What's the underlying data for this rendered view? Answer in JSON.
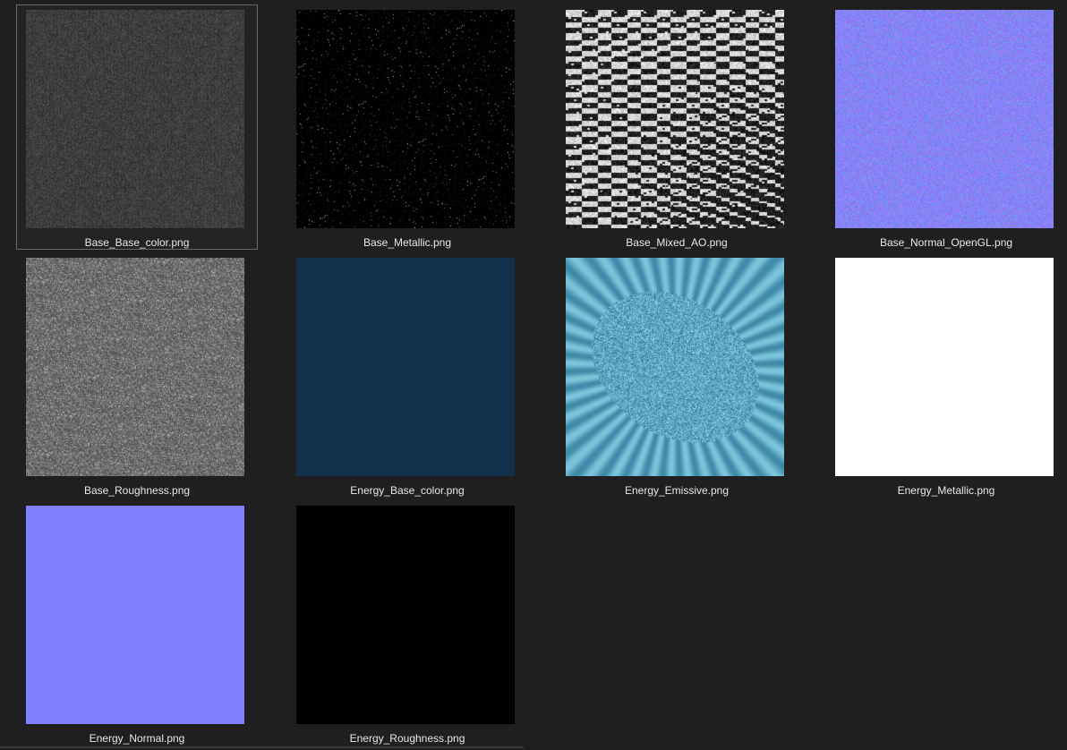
{
  "files": [
    {
      "name": "Base_Base_color.png",
      "selected": true,
      "kind": "noise-gray",
      "colors": [
        "#3c3c3c",
        "#4a4a4a",
        "#2e2e2e"
      ]
    },
    {
      "name": "Base_Metallic.png",
      "selected": false,
      "kind": "noise-dark",
      "colors": [
        "#000000",
        "#555555"
      ]
    },
    {
      "name": "Base_Mixed_AO.png",
      "selected": false,
      "kind": "noise-bw",
      "colors": [
        "#000000",
        "#ffffff"
      ]
    },
    {
      "name": "Base_Normal_OpenGL.png",
      "selected": false,
      "kind": "noise-normal",
      "colors": [
        "#7f7fff",
        "#a070e8",
        "#60b8d8",
        "#c080f0"
      ]
    },
    {
      "name": "Base_Roughness.png",
      "selected": false,
      "kind": "noise-gray-light",
      "colors": [
        "#6a6a6a",
        "#8a8a8a",
        "#505050"
      ]
    },
    {
      "name": "Energy_Base_color.png",
      "selected": false,
      "kind": "solid",
      "colors": [
        "#11304b"
      ]
    },
    {
      "name": "Energy_Emissive.png",
      "selected": false,
      "kind": "emissive",
      "colors": [
        "#5aa8c4",
        "#3f8aa8",
        "#7cc6dc",
        "#2f6f8c"
      ]
    },
    {
      "name": "Energy_Metallic.png",
      "selected": false,
      "kind": "solid",
      "colors": [
        "#ffffff"
      ]
    },
    {
      "name": "Energy_Normal.png",
      "selected": false,
      "kind": "solid",
      "colors": [
        "#7f7fff"
      ]
    },
    {
      "name": "Energy_Roughness.png",
      "selected": false,
      "kind": "solid",
      "colors": [
        "#000000"
      ]
    }
  ]
}
